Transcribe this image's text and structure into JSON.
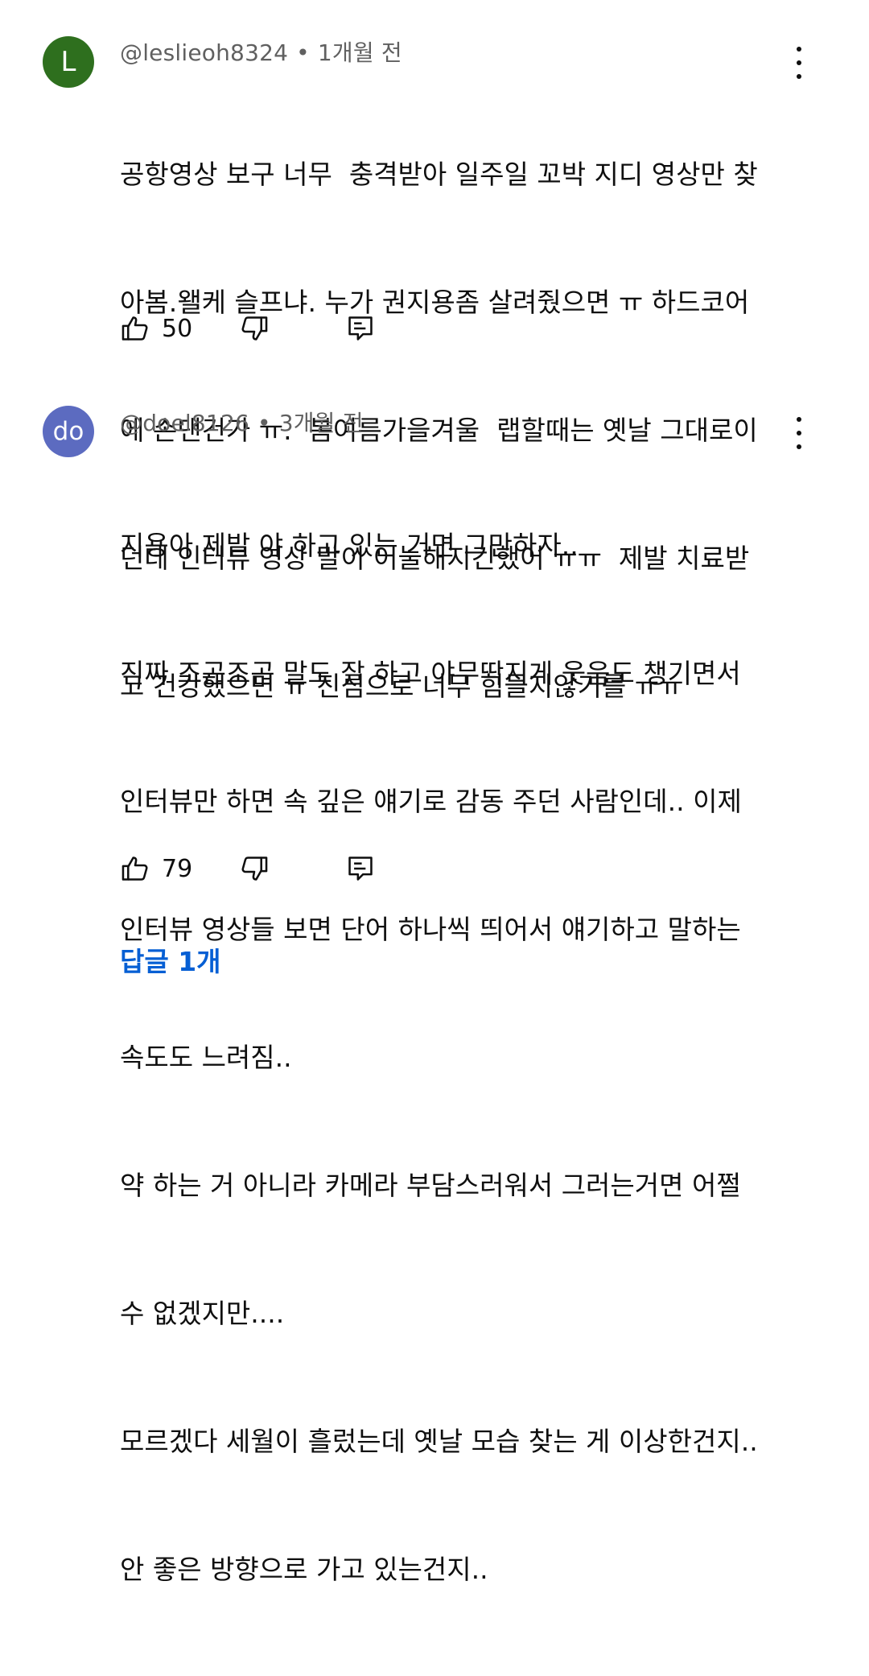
{
  "comments": [
    {
      "avatar_letter": "L",
      "avatar_color": "#2e6f1e",
      "handle": "@leslieoh8324",
      "separator": "•",
      "time": "1개월 전",
      "lines": [
        "공항영상 보구 너무  충격받아 일주일 꼬박 지디 영상만 찾",
        "아봄.왤케 슬프냐. 누가 권지용좀 살려줬으면 ㅠ 하드코어",
        "에 손댄건가 ㅠ.  봄여름가을겨울  랩할때는 옛날 그대로이",
        "던데 인터뷰 영상 말이 어눌해지긴했어 ㅠㅠ  제발 치료받",
        "고 건강했으면 ㅠ 진심으로 너무 힘들지않기를 ㅠㅠ"
      ],
      "likes": "50"
    },
    {
      "avatar_letter": "do",
      "avatar_color": "#5c6bc0",
      "handle": "@doel8126",
      "separator": "•",
      "time": "3개월 전",
      "lines": [
        "지용아 제발 야 하고 있는 거면 그만하자..",
        "진짜 조곤조곤 말도 잘 하고 야무딱지게 웃음도 챙기면서",
        "인터뷰만 하면 속 깊은 얘기로 감동 주던 사람인데.. 이제",
        "인터뷰 영상들 보면 단어 하나씩 띄어서 얘기하고 말하는",
        "속도도 느려짐..",
        "약 하는 거 아니라 카메라 부담스러워서 그러는거면 어쩔",
        "수 없겠지만....",
        "모르겠다 세월이 흘렀는데 옛날 모습 찾는 게 이상한건지..",
        "안 좋은 방향으로 가고 있는건지.."
      ],
      "likes": "79"
    }
  ],
  "replies_label": "답글 1개",
  "icons": {
    "like": "thumbs-up-icon",
    "dislike": "thumbs-down-icon",
    "reply": "reply-icon",
    "more": "more-vertical-icon"
  },
  "colors": {
    "link": "#065fd4",
    "meta": "#606060",
    "text": "#0f0f0f"
  }
}
